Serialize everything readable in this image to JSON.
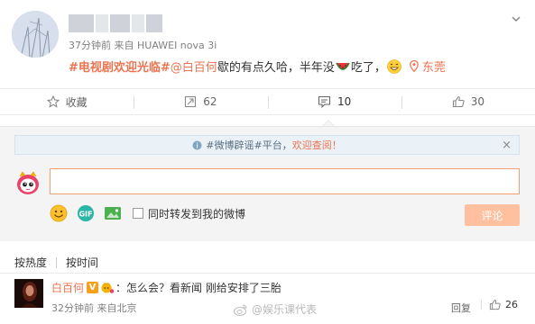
{
  "post": {
    "meta": "37分钟前  来自 HUAWEI nova 3i",
    "hashtag": "#电视剧欢迎光临#",
    "mention": "@白百何",
    "text_part1": " 歇的有点久哈，半年没",
    "text_part2": "吃了，",
    "location": "东莞"
  },
  "actions": {
    "favorite": "收藏",
    "repost": "62",
    "comment": "10",
    "like": "30"
  },
  "notice": {
    "prefix": "#微博辟谣#平台，",
    "link": "欢迎查阅！",
    "close": "×"
  },
  "comment_box": {
    "placeholder": "",
    "repost_label": "同时转发到我的微博",
    "submit_label": "评论"
  },
  "sort": {
    "hot": "按热度",
    "time": "按时间"
  },
  "comment": {
    "name": "白百何",
    "vbadge": "V",
    "text": "：怎么会？看新闻 刚给安排了三胎",
    "meta": "32分钟前  来自北京",
    "reply": "回复",
    "likes": "26"
  },
  "watermark": {
    "text": "@娱乐课代表"
  },
  "colors": {
    "accent": "#eb7350",
    "submit_disabled": "#ffc09f",
    "panel_bg": "#f4f4f4",
    "notice_bg": "#eaf2f8"
  },
  "icons": [
    "chevron-down-icon",
    "star-icon",
    "repost-icon",
    "comment-icon",
    "thumb-up-icon",
    "location-pin-icon",
    "emoji-icon",
    "gif-icon",
    "image-icon",
    "weibo-mascot-icon"
  ]
}
